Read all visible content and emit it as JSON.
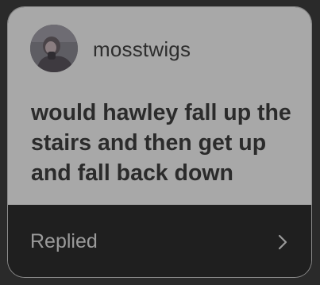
{
  "question": {
    "username": "mosstwigs",
    "text": "would hawley fall up the stairs and then get up and fall back down"
  },
  "footer": {
    "status_label": "Replied"
  },
  "icons": {
    "avatar": "user-avatar-photo",
    "chevron": "chevron-right-icon"
  },
  "colors": {
    "page_background": "#2a2a2a",
    "question_background": "#a8a8a8",
    "footer_background": "#1f1f1f",
    "text_dark": "#2b2b2b",
    "footer_text": "#9a9a9a"
  }
}
